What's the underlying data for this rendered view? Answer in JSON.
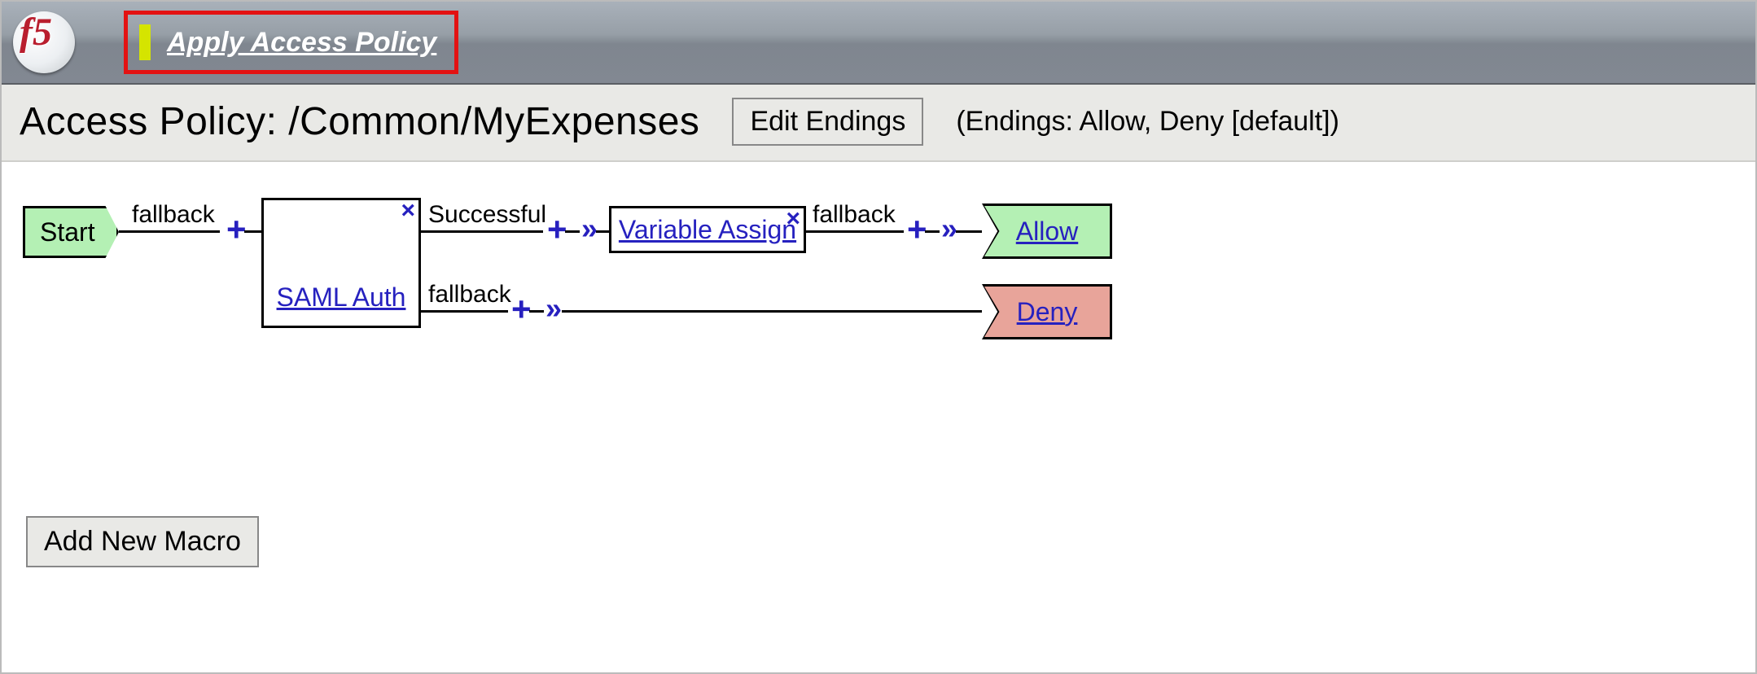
{
  "header": {
    "apply_link": "Apply Access Policy"
  },
  "subhead": {
    "title": "Access Policy: /Common/MyExpenses",
    "edit_endings": "Edit Endings",
    "endings_text": "(Endings: Allow, Deny [default])"
  },
  "flow": {
    "start": "Start",
    "saml": "SAML Auth",
    "var_assign": "Variable Assign",
    "allow": "Allow",
    "deny": "Deny",
    "branch_start_fallback": "fallback",
    "branch_success": "Successful",
    "branch_var_fallback": "fallback",
    "branch_fail": "fallback",
    "node_close": "×"
  },
  "footer": {
    "add_macro": "Add New Macro"
  }
}
